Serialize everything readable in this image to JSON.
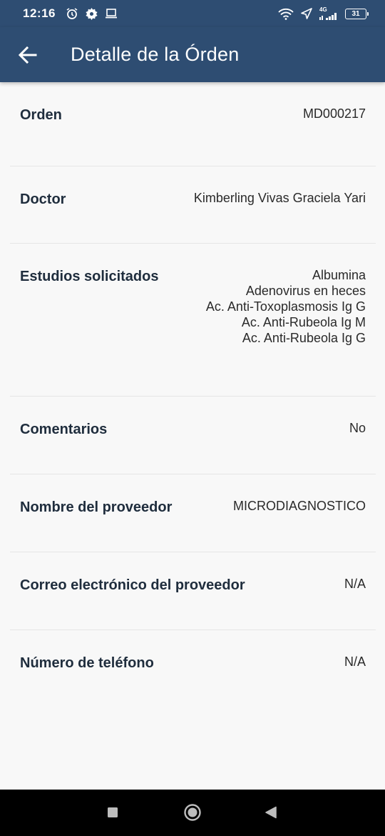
{
  "status_bar": {
    "time": "12:16",
    "network": "4G",
    "battery": "31"
  },
  "app_bar": {
    "title": "Detalle de la Órden"
  },
  "details": [
    {
      "label": "Orden",
      "values": [
        "MD000217"
      ]
    },
    {
      "label": "Doctor",
      "values": [
        "Kimberling Vivas Graciela Yari"
      ]
    },
    {
      "label": "Estudios solicitados",
      "values": [
        "Albumina",
        "Adenovirus en heces",
        "Ac. Anti-Toxoplasmosis Ig G",
        "Ac. Anti-Rubeola Ig M",
        "Ac. Anti-Rubeola Ig G"
      ]
    },
    {
      "label": "Comentarios",
      "values": [
        "No"
      ]
    },
    {
      "label": "Nombre del proveedor",
      "values": [
        "MICRODIAGNOSTICO"
      ]
    },
    {
      "label": "Correo electrónico del proveedor",
      "values": [
        "N/A"
      ]
    },
    {
      "label": "Número de teléfono",
      "values": [
        "N/A"
      ]
    }
  ],
  "colors": {
    "primary": "#2e4d72",
    "background": "#f8f8f8",
    "label": "#1f2d3d"
  },
  "icons": {
    "back": "arrow-left-icon",
    "nav": [
      "square-icon",
      "circle-icon",
      "triangle-back-icon"
    ]
  }
}
